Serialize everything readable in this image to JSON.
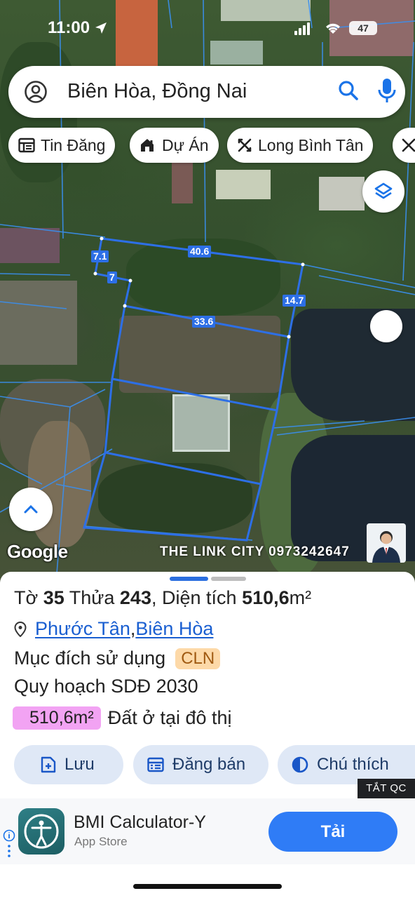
{
  "status_bar": {
    "time": "11:00",
    "battery": "47"
  },
  "search": {
    "query": "Biên Hòa, Đồng Nai"
  },
  "chips": [
    {
      "label": "Tin Đăng",
      "icon": "listing-icon"
    },
    {
      "label": "Dự Án",
      "icon": "house-icon"
    },
    {
      "label": "Long  Bình Tân",
      "icon": "route-icon"
    }
  ],
  "map": {
    "dimensions": [
      "7.1",
      "7",
      "40.6",
      "14.7",
      "33.6"
    ],
    "google_label": "Google",
    "watermark": "THE LINK CITY 0973242647"
  },
  "parcel": {
    "to_label": "Tờ",
    "to_value": "35",
    "thua_label": "Thửa",
    "thua_value": "243",
    "area_label": "Diện tích",
    "area_value": "510,6",
    "area_unit": "m²",
    "ward": "Phước Tân",
    "city": "Biên Hòa",
    "purpose_label": "Mục đích sử dụng",
    "purpose_code": "CLN",
    "planning_label": "Quy hoạch SDĐ 2030",
    "planning_area": "510,6m²",
    "planning_type": "Đất ở tại đô thị"
  },
  "actions": [
    {
      "label": "Lưu",
      "icon": "add-doc-icon"
    },
    {
      "label": "Đăng bán",
      "icon": "calendar-list-icon"
    },
    {
      "label": "Chú thích",
      "icon": "contrast-icon"
    }
  ],
  "ad": {
    "hide_label": "TẮT QC",
    "app_name": "BMI Calculator-Y",
    "store": "App Store",
    "cta": "Tải"
  },
  "colors": {
    "accent": "#2f7cf6",
    "parcel_line": "#2d6fe6",
    "cln_badge": "#fdd9a8",
    "area_badge": "#f2a3f3"
  }
}
